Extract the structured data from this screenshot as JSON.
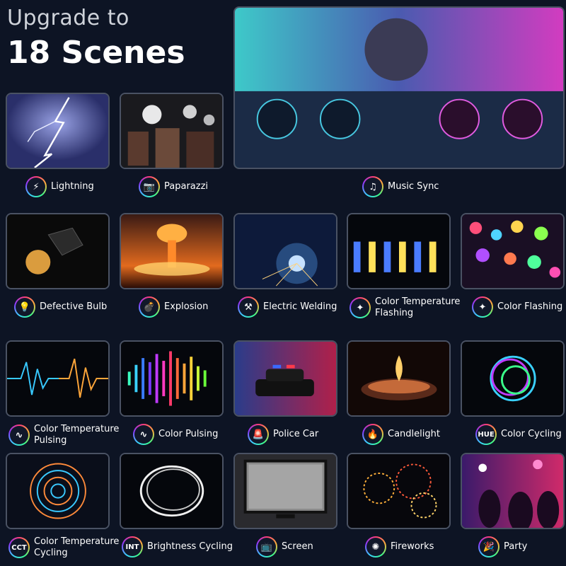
{
  "header": {
    "line1": "Upgrade to",
    "line2": "18 Scenes"
  },
  "scenes": [
    {
      "name": "Lightning",
      "icon": "lightning-icon",
      "glyph": "⚡"
    },
    {
      "name": "Paparazzi",
      "icon": "camera-icon",
      "glyph": "📷"
    },
    {
      "name": "Music Sync",
      "icon": "music-note-icon",
      "glyph": "♫"
    },
    {
      "name": "Defective Bulb",
      "icon": "bulb-icon",
      "glyph": "💡"
    },
    {
      "name": "Explosion",
      "icon": "bomb-icon",
      "glyph": "💣"
    },
    {
      "name": "Electric Welding",
      "icon": "welding-icon",
      "glyph": "⚒"
    },
    {
      "name": "Color Temperature Flashing",
      "icon": "sparkle-icon",
      "glyph": "✦"
    },
    {
      "name": "Color Flashing",
      "icon": "sparkle-icon",
      "glyph": "✦"
    },
    {
      "name": "Color Temperature Pulsing",
      "icon": "pulse-icon",
      "glyph": "∿"
    },
    {
      "name": "Color Pulsing",
      "icon": "pulse-icon",
      "glyph": "∿"
    },
    {
      "name": "Police Car",
      "icon": "siren-icon",
      "glyph": "🚨"
    },
    {
      "name": "Candlelight",
      "icon": "flame-icon",
      "glyph": "🔥"
    },
    {
      "name": "Color Cycling",
      "icon": "hue-icon",
      "glyph": "HUE"
    },
    {
      "name": "Color Temperature Cycling",
      "icon": "cct-icon",
      "glyph": "CCT"
    },
    {
      "name": "Brightness Cycling",
      "icon": "int-icon",
      "glyph": "INT"
    },
    {
      "name": "Screen",
      "icon": "tv-icon",
      "glyph": "📺"
    },
    {
      "name": "Fireworks",
      "icon": "firework-icon",
      "glyph": "✺"
    },
    {
      "name": "Party",
      "icon": "party-icon",
      "glyph": "🎉"
    }
  ],
  "scene_label_lines": {
    "6": [
      "Color Temperature",
      "Flashing"
    ],
    "8": [
      "Color Temperature",
      "Pulsing"
    ],
    "13": [
      "Color Temperature",
      "Cycling"
    ]
  }
}
